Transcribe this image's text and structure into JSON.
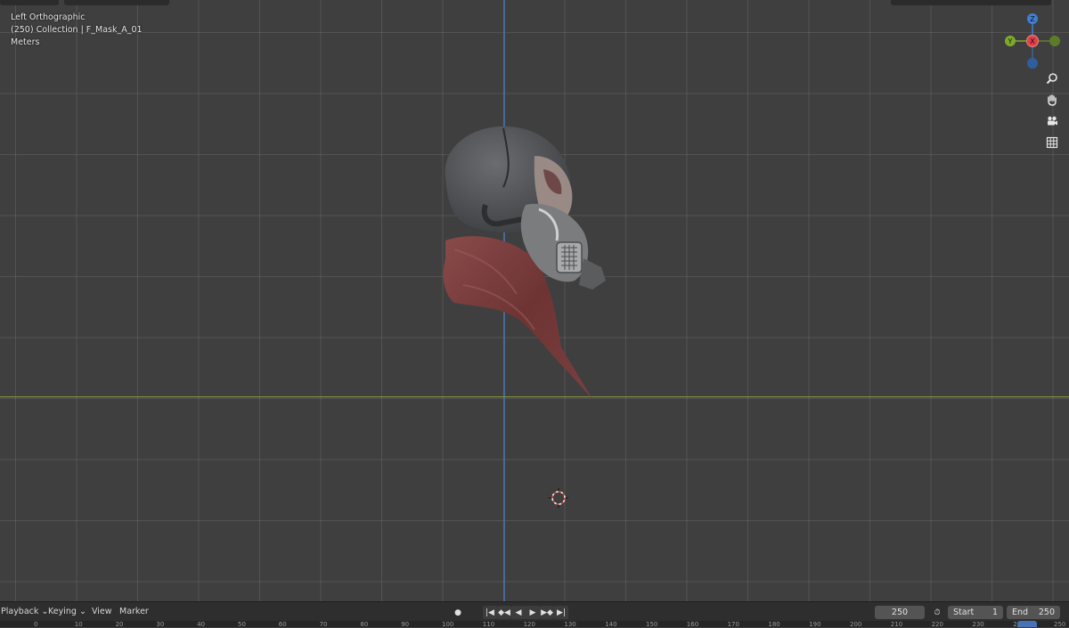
{
  "viewport": {
    "view_name": "Left Orthographic",
    "collection_info": "(250) Collection | F_Mask_A_01",
    "units": "Meters"
  },
  "gizmo": {
    "z": "Z",
    "y": "Y",
    "x": "X"
  },
  "nav_icons": [
    "zoom-icon",
    "hand-pan-icon",
    "camera-icon",
    "grid-ortho-icon"
  ],
  "colors": {
    "x_axis": "#e0404a",
    "y_axis": "#7cab2b",
    "z_axis": "#3f7fd6",
    "accent": "#4772b3"
  },
  "timeline": {
    "playback": "Playback",
    "keying": "Keying",
    "view": "View",
    "marker": "Marker",
    "current_frame": "250",
    "start_label": "Start",
    "start_value": "1",
    "end_label": "End",
    "end_value": "250"
  },
  "ruler_ticks": [
    "0",
    "10",
    "20",
    "30",
    "40",
    "50",
    "60",
    "70",
    "80",
    "90",
    "100",
    "110",
    "120",
    "130",
    "140",
    "150",
    "160",
    "170",
    "180",
    "190",
    "200",
    "210",
    "220",
    "230",
    "240",
    "250"
  ]
}
